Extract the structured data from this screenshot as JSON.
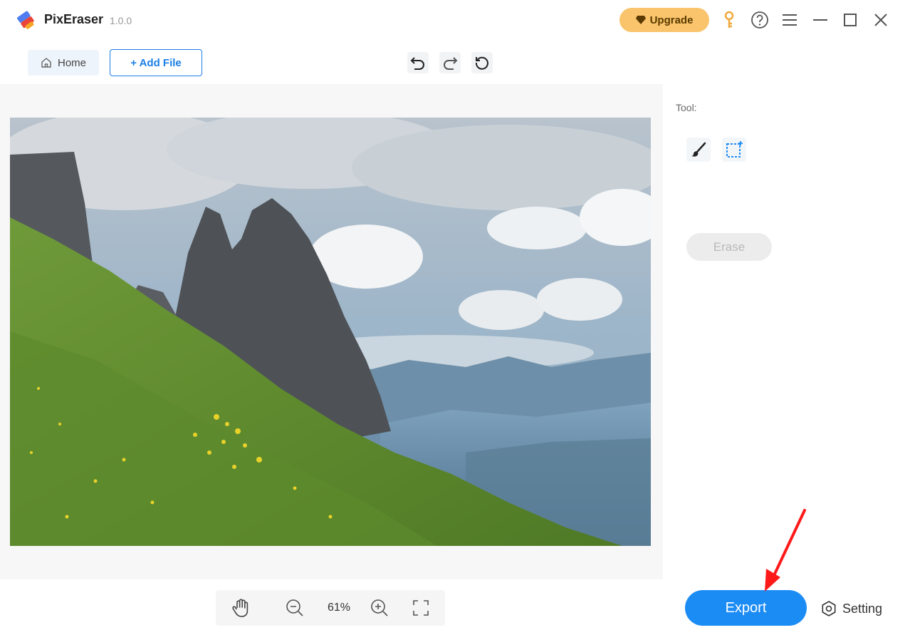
{
  "app": {
    "name": "PixEraser",
    "version": "1.0.0"
  },
  "titlebar": {
    "upgrade_label": "Upgrade",
    "icons": [
      "key-icon",
      "help-icon",
      "menu-icon",
      "minimize-icon",
      "maximize-icon",
      "close-icon"
    ]
  },
  "toolbar": {
    "home_label": "Home",
    "add_file_label": "+ Add File",
    "history": [
      "undo-icon",
      "redo-icon",
      "reset-icon"
    ]
  },
  "panel": {
    "tool_label": "Tool:",
    "tools": [
      "brush-icon",
      "rect-select-icon"
    ],
    "erase_label": "Erase"
  },
  "zoom": {
    "value": "61%"
  },
  "bottom": {
    "export_label": "Export",
    "setting_label": "Setting"
  },
  "colors": {
    "accent": "#1c8cf5",
    "upgrade": "#f9c46b",
    "key": "#f0a93a",
    "annotation": "#ff1a1a"
  }
}
